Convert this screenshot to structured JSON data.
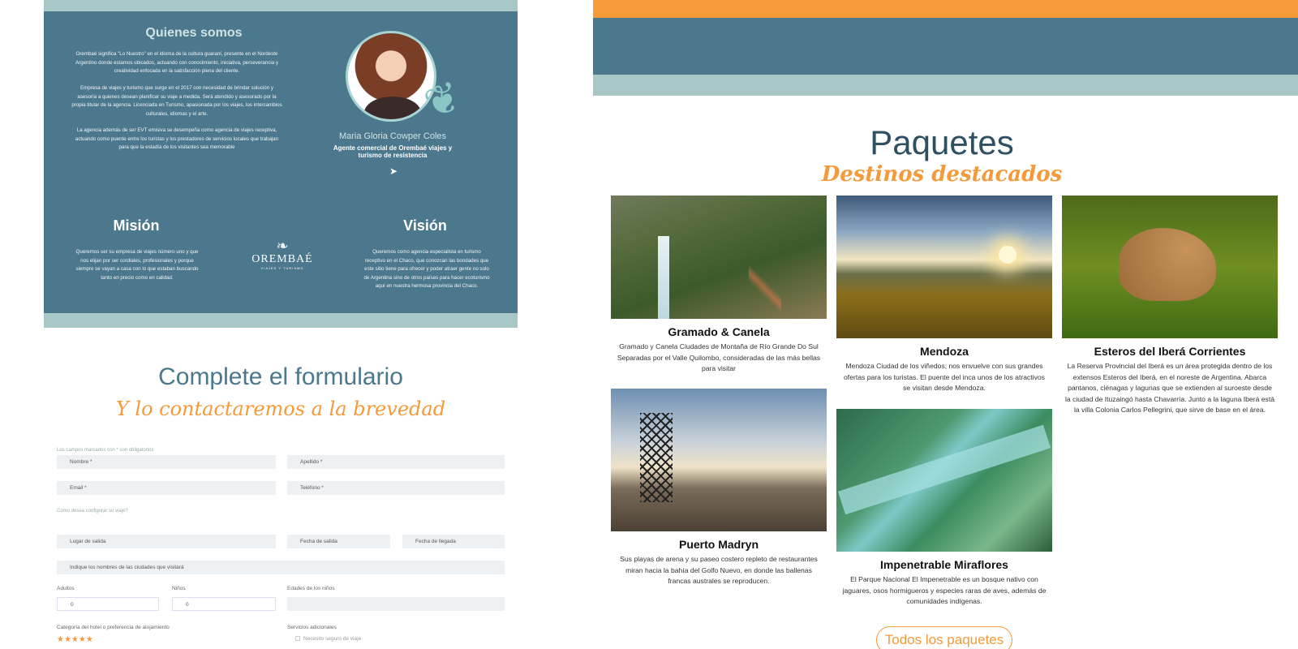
{
  "about": {
    "title": "Quienes somos",
    "paragraphs": [
      "Orembaé significa \"Lo Nuestro\" en el idioma de la cultura guaraní, presente en el Nordeste Argentino donde estamos ubicados, actuando con conocimiento, iniciativa, perseverancia y creatividad enfocada en la satisfacción plena del cliente.",
      "Empresa de viajes y turismo que surge en el 2017 con necesidad de brindar solución y asesoría a quienes desean planificar su viaje a medida. Será atendido y asesorado por la propia titular de la agencia. Licenciada en Turismo, apasionada por los viajes, los intercambios culturales, idiomas y el arte.",
      "La agencia además de ser EVT emisiva se desempeña como agencia de viajes receptiva, actuando como puente entre los turistas y los prestadores de servicios locales que trabajan para que la estadía de los visitantes sea memorable"
    ],
    "person_name": "Maria Gloria Cowper Coles",
    "person_role": "Agente comercial de Orembaé viajes y turismo de resistencia",
    "mision_title": "Misión",
    "mision_text": "Queremos ser su empresa de viajes número uno y que nos elijan por ser cordiales, profesionales y porque siempre se vayan a casa con lo que estaban buscando tanto en precio como en calidad.",
    "vision_title": "Visión",
    "vision_text": "Queremos como agencia especialista en turismo receptivo en el Chaco, que conozcan las bondades que este sitio tiene para ofrecer y poder atraer gente no solo de Argentina sino de otros países para hacer ecoturismo aquí en nuestra hermosa provincia del Chaco.",
    "logo_text": "OREMBAÉ",
    "logo_sub": "VIAJES Y TURISMO"
  },
  "form": {
    "title": "Complete el formulario",
    "subtitle": "Y lo contactaremos a la brevedad",
    "required_note": "Los campos marcados con * son obligatorios",
    "nombre": "Nombre *",
    "apellido": "Apellido *",
    "email": "Email *",
    "telefono": "Teléfono *",
    "config_note": "Como desea configurar su viaje?",
    "lugar_salida": "Lugar de salida",
    "fecha_salida": "Fecha de salida",
    "fecha_llegada": "Fecha de llegada",
    "ciudades": "Indique los nombres de las ciudades que visitará",
    "adultos_label": "Adultos",
    "adultos_value": "0",
    "ninos_label": "Niños",
    "ninos_value": "0",
    "edades_label": "Edades de los niños",
    "hotel_label": "Categoría del hotel o preferencia de alojamiento",
    "stars": "★★★★★",
    "servicios_label": "Servicios adicionales",
    "seguro_label": "Necesito seguro de viaje"
  },
  "packages": {
    "title": "Paquetes",
    "subtitle": "Destinos destacados",
    "items": [
      {
        "name": "Gramado & Canela",
        "desc": "Gramado y Canela Ciudades de Montaña de Río Grande Do Sul Separadas por el Valle Quilombo, consideradas de las más bellas para visitar"
      },
      {
        "name": "Mendoza",
        "desc": "Mendoza Ciudad de los viñedos; nos envuelve con sus grandes ofertas para los turistas. El puente del inca unos de los atractivos se visitan desde Mendoza."
      },
      {
        "name": "Esteros del Iberá Corrientes",
        "desc": "La Reserva Provincial del Iberá es un área protegida dentro de los extensos Esteros del Iberá, en el noreste de Argentina. Abarca pantanos, ciénagas y lagunas que se extienden al suroeste desde la ciudad de Ituzaingó hasta Chavarría. Junto a la laguna Iberá está la villa Colonia Carlos Pellegrini, que sirve de base en el área."
      },
      {
        "name": "Puerto Madryn",
        "desc": "Sus playas de arena y su paseo costero repleto de restaurantes miran hacia la bahía del Golfo Nuevo, en donde las ballenas francas australes se reproducen."
      },
      {
        "name": "Impenetrable Miraflores",
        "desc": "El Parque Nacional El Impenetrable es un bosque nativo con jaguares, osos hormigueros y especies raras de aves, además de comunidades indígenas."
      }
    ],
    "button": "Todos los paquetes"
  },
  "colors": {
    "teal_dark": "#4b788d",
    "teal_light": "#a8c8c8",
    "orange": "#f79a3a"
  }
}
